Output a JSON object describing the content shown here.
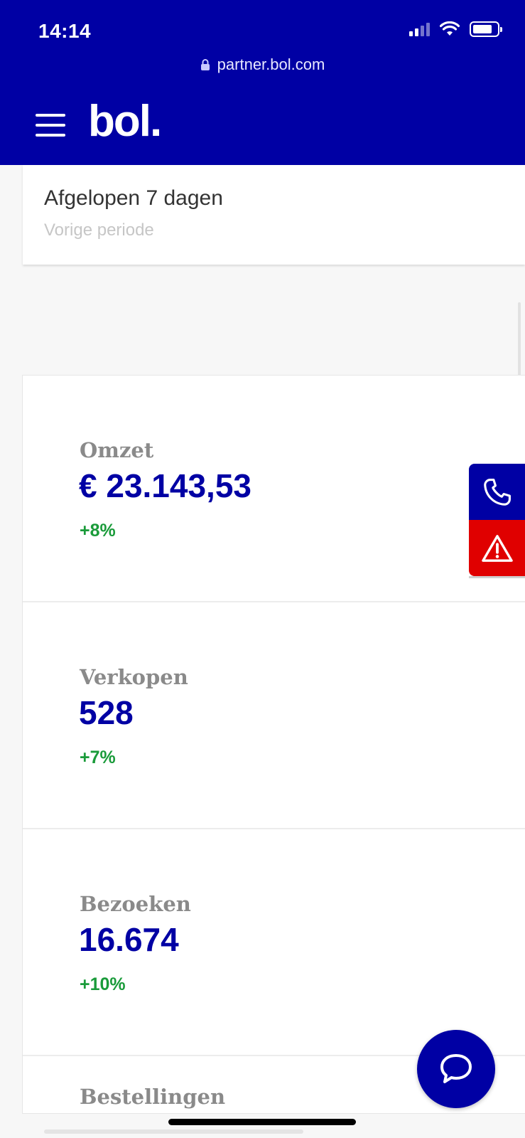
{
  "status_bar": {
    "time": "14:14",
    "icons": [
      "signal-icon",
      "wifi-icon",
      "battery-icon"
    ],
    "battery_level_fraction": 0.8
  },
  "browser": {
    "url": "partner.bol.com"
  },
  "header": {
    "logo_text": "bol.",
    "menu_icon": "hamburger-menu-icon",
    "background_color": "#0000a4"
  },
  "period": {
    "title": "Afgelopen 7 dagen",
    "subtitle": "Vorige periode"
  },
  "metrics": [
    {
      "label": "Omzet",
      "value": "€ 23.143,53",
      "change": "+8%"
    },
    {
      "label": "Verkopen",
      "value": "528",
      "change": "+7%"
    },
    {
      "label": "Bezoeken",
      "value": "16.674",
      "change": "+10%"
    },
    {
      "label": "Bestellingen"
    }
  ],
  "side_actions": {
    "phone_icon": "phone-icon",
    "alert_icon": "warning-icon",
    "phone_color": "#0000a4",
    "alert_color": "#e00000"
  },
  "chat": {
    "icon": "chat-bubble-icon"
  },
  "colors": {
    "value": "#0000a4",
    "label": "#8a8a8a",
    "positive_change": "#1a9b3a"
  }
}
